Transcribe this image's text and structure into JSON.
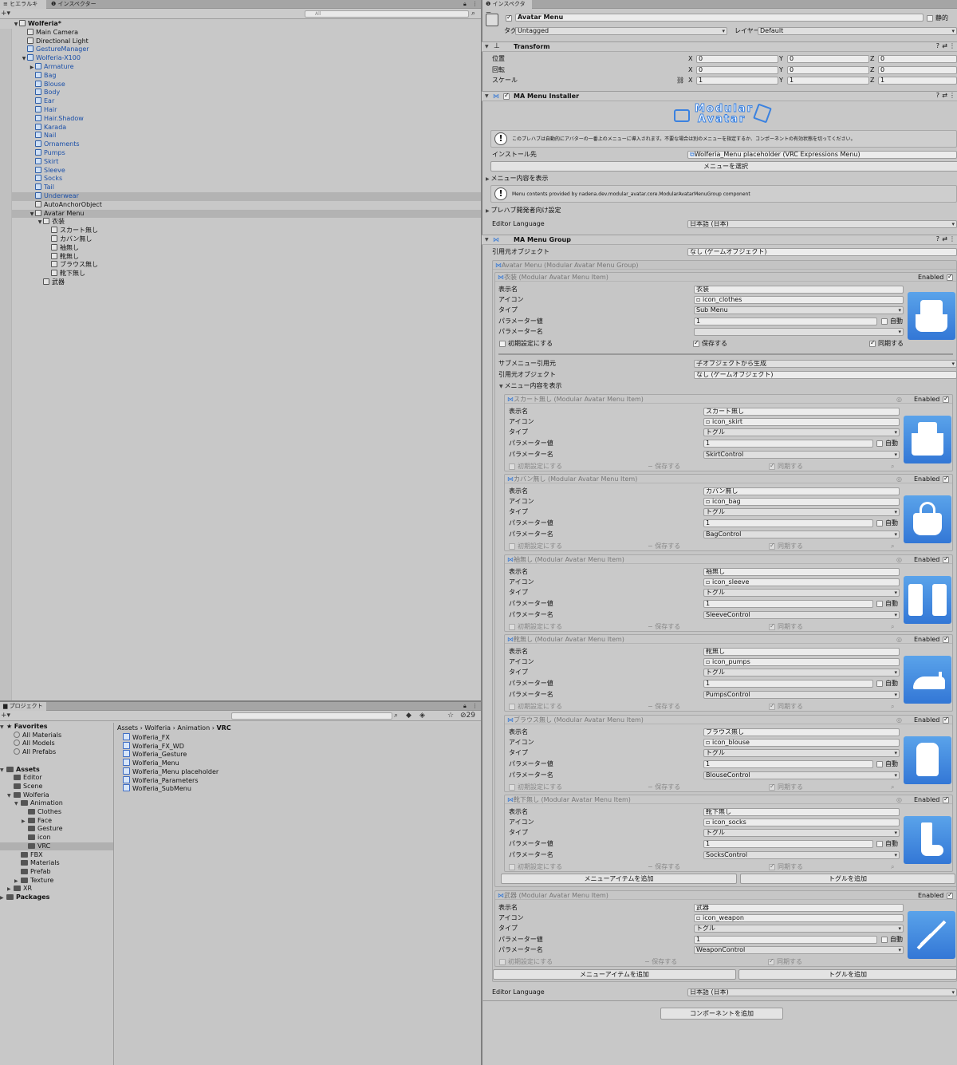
{
  "hierarchy": {
    "tab_label": "ヒエラルキー",
    "other_tab": "インスペクター",
    "search_placeholder": "All",
    "rows": [
      {
        "label": "Wolferia*",
        "depth": 0,
        "arrow": "▼",
        "bold": true,
        "icon": "unity",
        "blue": false
      },
      {
        "label": "Main Camera",
        "depth": 1,
        "arrow": "",
        "icon": "cube",
        "blue": false
      },
      {
        "label": "Directional Light",
        "depth": 1,
        "arrow": "",
        "icon": "cube",
        "blue": false
      },
      {
        "label": "GestureManager",
        "depth": 1,
        "arrow": "",
        "icon": "cube",
        "blue": true
      },
      {
        "label": "Wolferia-X100",
        "depth": 1,
        "arrow": "▼",
        "icon": "cube",
        "blue": true
      },
      {
        "label": "Armature",
        "depth": 2,
        "arrow": "▶",
        "icon": "cube",
        "blue": true
      },
      {
        "label": "Bag",
        "depth": 2,
        "arrow": "",
        "icon": "cube",
        "blue": true
      },
      {
        "label": "Blouse",
        "depth": 2,
        "arrow": "",
        "icon": "cube",
        "blue": true
      },
      {
        "label": "Body",
        "depth": 2,
        "arrow": "",
        "icon": "cube",
        "blue": true
      },
      {
        "label": "Ear",
        "depth": 2,
        "arrow": "",
        "icon": "cube",
        "blue": true
      },
      {
        "label": "Hair",
        "depth": 2,
        "arrow": "",
        "icon": "cube",
        "blue": true
      },
      {
        "label": "Hair.Shadow",
        "depth": 2,
        "arrow": "",
        "icon": "cube",
        "blue": true
      },
      {
        "label": "Karada",
        "depth": 2,
        "arrow": "",
        "icon": "cube",
        "blue": true
      },
      {
        "label": "Nail",
        "depth": 2,
        "arrow": "",
        "icon": "cube",
        "blue": true
      },
      {
        "label": "Ornaments",
        "depth": 2,
        "arrow": "",
        "icon": "cube",
        "blue": true
      },
      {
        "label": "Pumps",
        "depth": 2,
        "arrow": "",
        "icon": "cube",
        "blue": true
      },
      {
        "label": "Skirt",
        "depth": 2,
        "arrow": "",
        "icon": "cube",
        "blue": true
      },
      {
        "label": "Sleeve",
        "depth": 2,
        "arrow": "",
        "icon": "cube",
        "blue": true
      },
      {
        "label": "Socks",
        "depth": 2,
        "arrow": "",
        "icon": "cube",
        "blue": true
      },
      {
        "label": "Tail",
        "depth": 2,
        "arrow": "",
        "icon": "cube",
        "blue": true
      },
      {
        "label": "Underwear",
        "depth": 2,
        "arrow": "",
        "icon": "cube",
        "blue": true,
        "sel": true
      },
      {
        "label": "AutoAnchorObject",
        "depth": 2,
        "arrow": "",
        "icon": "cube",
        "blue": false
      },
      {
        "label": "Avatar Menu",
        "depth": 2,
        "arrow": "▼",
        "icon": "cube",
        "blue": false,
        "sel": true
      },
      {
        "label": "衣装",
        "depth": 3,
        "arrow": "▼",
        "icon": "cube",
        "blue": false
      },
      {
        "label": "スカート無し",
        "depth": 4,
        "arrow": "",
        "icon": "cube",
        "blue": false
      },
      {
        "label": "カバン無し",
        "depth": 4,
        "arrow": "",
        "icon": "cube",
        "blue": false
      },
      {
        "label": "袖無し",
        "depth": 4,
        "arrow": "",
        "icon": "cube",
        "blue": false
      },
      {
        "label": "靴無し",
        "depth": 4,
        "arrow": "",
        "icon": "cube",
        "blue": false
      },
      {
        "label": "ブラウス無し",
        "depth": 4,
        "arrow": "",
        "icon": "cube",
        "blue": false
      },
      {
        "label": "靴下無し",
        "depth": 4,
        "arrow": "",
        "icon": "cube",
        "blue": false
      },
      {
        "label": "武器",
        "depth": 3,
        "arrow": "",
        "icon": "cube",
        "blue": false
      }
    ]
  },
  "project": {
    "tab_label": "プロジェクト",
    "count": "29",
    "tree": [
      {
        "label": "Favorites",
        "depth": 0,
        "arrow": "▼",
        "kind": "star",
        "bold": true
      },
      {
        "label": "All Materials",
        "depth": 1,
        "arrow": "",
        "kind": "search"
      },
      {
        "label": "All Models",
        "depth": 1,
        "arrow": "",
        "kind": "search"
      },
      {
        "label": "All Prefabs",
        "depth": 1,
        "arrow": "",
        "kind": "search"
      },
      {
        "label": "",
        "depth": 0,
        "arrow": "",
        "kind": "none"
      },
      {
        "label": "Assets",
        "depth": 0,
        "arrow": "▼",
        "kind": "folder",
        "bold": true
      },
      {
        "label": "Editor",
        "depth": 1,
        "arrow": "",
        "kind": "folder"
      },
      {
        "label": "Scene",
        "depth": 1,
        "arrow": "",
        "kind": "folder"
      },
      {
        "label": "Wolferia",
        "depth": 1,
        "arrow": "▼",
        "kind": "folder"
      },
      {
        "label": "Animation",
        "depth": 2,
        "arrow": "▼",
        "kind": "folder"
      },
      {
        "label": "Clothes",
        "depth": 3,
        "arrow": "",
        "kind": "folder"
      },
      {
        "label": "Face",
        "depth": 3,
        "arrow": "▶",
        "kind": "folder"
      },
      {
        "label": "Gesture",
        "depth": 3,
        "arrow": "",
        "kind": "folder"
      },
      {
        "label": "icon",
        "depth": 3,
        "arrow": "",
        "kind": "folder"
      },
      {
        "label": "VRC",
        "depth": 3,
        "arrow": "",
        "kind": "folder",
        "sel": true
      },
      {
        "label": "FBX",
        "depth": 2,
        "arrow": "",
        "kind": "folder"
      },
      {
        "label": "Materials",
        "depth": 2,
        "arrow": "",
        "kind": "folder"
      },
      {
        "label": "Prefab",
        "depth": 2,
        "arrow": "",
        "kind": "folder"
      },
      {
        "label": "Texture",
        "depth": 2,
        "arrow": "▶",
        "kind": "folder"
      },
      {
        "label": "XR",
        "depth": 1,
        "arrow": "▶",
        "kind": "folder"
      },
      {
        "label": "Packages",
        "depth": 0,
        "arrow": "▶",
        "kind": "folder",
        "bold": true
      }
    ],
    "breadcrumb": [
      "Assets",
      "Wolferia",
      "Animation",
      "VRC"
    ],
    "assets": [
      "Wolferia_FX",
      "Wolferia_FX_WD",
      "Wolferia_Gesture",
      "Wolferia_Menu",
      "Wolferia_Menu placeholder",
      "Wolferia_Parameters",
      "Wolferia_SubMenu"
    ]
  },
  "inspector": {
    "tab_label": "インスペクター",
    "object_name": "Avatar Menu",
    "static_label": "静的",
    "tag_label": "タグ",
    "tag_value": "Untagged",
    "layer_label": "レイヤー",
    "layer_value": "Default",
    "transform": {
      "title": "Transform",
      "rows": [
        {
          "label": "位置",
          "x": "0",
          "y": "0",
          "z": "0"
        },
        {
          "label": "回転",
          "x": "0",
          "y": "0",
          "z": "0"
        },
        {
          "label": "スケール",
          "x": "1",
          "y": "1",
          "z": "1"
        }
      ],
      "axis_x": "X",
      "axis_y": "Y",
      "axis_z": "Z"
    },
    "installer": {
      "title": "MA Menu Installer",
      "logo_line1": "Modular",
      "logo_line2": "Avatar",
      "help1": "このプレハブは自動的にアバターの一番上のメニューに導入されます。不要な場合は別のメニューを指定するか、コンポーネントの有効状態を切ってください。",
      "install_label": "インストール先",
      "install_value": "Wolferia_Menu placeholder (VRC Expressions Menu)",
      "select_menu": "メニューを選択",
      "show_menu": "メニュー内容を表示",
      "help2": "Menu contents provided by nadena.dev.modular_avatar.core.ModularAvatarMenuGroup component",
      "dev_settings": "プレハブ開発者向け設定",
      "editor_lang_label": "Editor Language",
      "editor_lang_value": "日本語 (日本)"
    },
    "group": {
      "title": "MA Menu Group",
      "source_label": "引用元オブジェクト",
      "source_value": "なし (ゲームオブジェクト)",
      "box_title": "Avatar Menu (Modular Avatar Menu Group)",
      "enabled": "Enabled",
      "labels": {
        "name": "表示名",
        "icon": "アイコン",
        "type": "タイプ",
        "param_value": "パラメーター値",
        "param_name": "パラメーター名",
        "auto": "自動",
        "default": "初期設定にする",
        "saved": "保存する",
        "synced": "同期する"
      },
      "clothes": {
        "box_title": "衣装 (Modular Avatar Menu Item)",
        "name": "衣装",
        "icon": "icon_clothes",
        "type": "Sub Menu",
        "param_value": "1",
        "param_name": "",
        "submenu_label": "サブメニュー引用元",
        "submenu_value": "子オブジェクトから生成",
        "source_label": "引用元オブジェクト",
        "source_value": "なし (ゲームオブジェクト)",
        "show_menu": "メニュー内容を表示",
        "add_item": "メニューアイテムを追加",
        "add_toggle": "トグルを追加"
      },
      "subitems": [
        {
          "box_title": "スカート無し (Modular Avatar Menu Item)",
          "name": "スカート無し",
          "icon": "icon_skirt",
          "type": "トグル",
          "param_value": "1",
          "param_name": "SkirtControl",
          "pic": "skirt"
        },
        {
          "box_title": "カバン無し (Modular Avatar Menu Item)",
          "name": "カバン無し",
          "icon": "icon_bag",
          "type": "トグル",
          "param_value": "1",
          "param_name": "BagControl",
          "pic": "bag"
        },
        {
          "box_title": "袖無し (Modular Avatar Menu Item)",
          "name": "袖無し",
          "icon": "icon_sleeve",
          "type": "トグル",
          "param_value": "1",
          "param_name": "SleeveControl",
          "pic": "sleeve"
        },
        {
          "box_title": "靴無し (Modular Avatar Menu Item)",
          "name": "靴無し",
          "icon": "icon_pumps",
          "type": "トグル",
          "param_value": "1",
          "param_name": "PumpsControl",
          "pic": "pumps"
        },
        {
          "box_title": "ブラウス無し (Modular Avatar Menu Item)",
          "name": "ブラウス無し",
          "icon": "icon_blouse",
          "type": "トグル",
          "param_value": "1",
          "param_name": "BlouseControl",
          "pic": "blouse"
        },
        {
          "box_title": "靴下無し (Modular Avatar Menu Item)",
          "name": "靴下無し",
          "icon": "icon_socks",
          "type": "トグル",
          "param_value": "1",
          "param_name": "SocksControl",
          "pic": "socks"
        }
      ],
      "weapon": {
        "box_title": "武器 (Modular Avatar Menu Item)",
        "name": "武器",
        "icon": "icon_weapon",
        "type": "トグル",
        "param_value": "1",
        "param_name": "WeaponControl"
      },
      "add_item": "メニューアイテムを追加",
      "add_toggle": "トグルを追加",
      "editor_lang_label": "Editor Language",
      "editor_lang_value": "日本語 (日本)",
      "add_component": "コンポーネントを追加"
    }
  },
  "colors": {
    "accent": "#3377d6",
    "selection": "#b3b3b3",
    "link": "#1a4fa8"
  }
}
